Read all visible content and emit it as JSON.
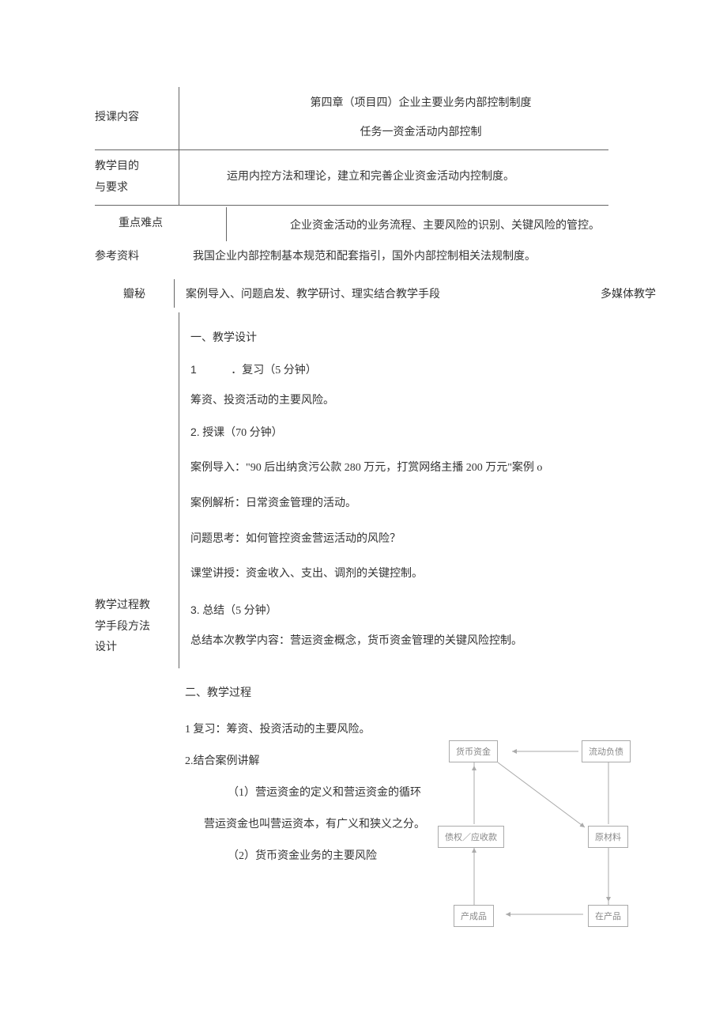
{
  "labels": {
    "course_content": "授课内容",
    "objective": "教学目的",
    "objective2": "与要求",
    "keypoints": "重点难点",
    "reference": "参考资料",
    "method_label": "瓣秘",
    "media_label": "多媒体教学",
    "process_label1": "教学过程教",
    "process_label2": "学手段方法",
    "process_label3": "设计"
  },
  "course": {
    "title1": "第四章（项目四）企业主要业务内部控制制度",
    "title2": "任务一资金活动内部控制"
  },
  "objective_text": "运用内控方法和理论，建立和完善企业资金活动内控制度。",
  "keypoints_text": "企业资金活动的业务流程、主要风险的识别、关键风险的管控。",
  "reference_text": "我国企业内部控制基本规范和配套指引，国外内部控制相关法规制度。",
  "method_text": "案例导入、问题启发、教学研讨、理实结合教学手段",
  "design": {
    "heading1": "一、教学设计",
    "item1_num": "1",
    "item1_title": "．复习（5 分钟）",
    "item1_body": "筹资、投资活动的主要风险。",
    "item2_num": "2.",
    "item2_title": " 授课（70 分钟）",
    "item2_l1": "案例导入：\"90 后出纳贪污公款 280 万元，打赏网络主播 200 万元\"案例 o",
    "item2_l2": "案例解析：日常资金管理的活动。",
    "item2_l3": "问题思考：如何管控资金营运活动的风险？",
    "item2_l4": "课堂讲授：资金收入、支出、调剂的关键控制。",
    "item3_num": "3.",
    "item3_title": " 总结（5 分钟）",
    "item3_body": "总结本次教学内容：营运资金概念，货币资金管理的关键风险控制。"
  },
  "process": {
    "heading2": "二、教学过程",
    "p1": "1 复习：筹资、投资活动的主要风险。",
    "p2": "2.结合案例讲解",
    "p2_1": "（1）营运资金的定义和营运资金的循环",
    "p2_2": "营运资金也叫营运资本，有广义和狭义之分。",
    "p2_3": "（2）货币资金业务的主要风险"
  },
  "diagram": {
    "box1": "货币资金",
    "box2": "流动负债",
    "box3": "债权／应收款",
    "box4": "原材料",
    "box5": "产成品",
    "box6": "在产品"
  }
}
